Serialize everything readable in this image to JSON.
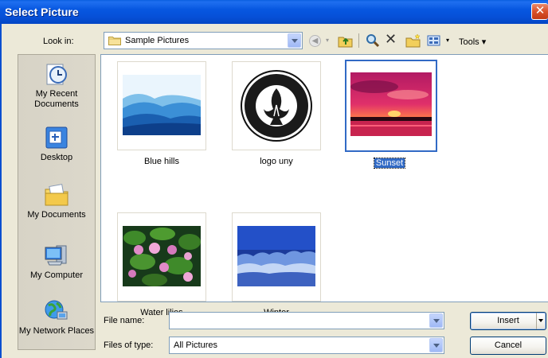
{
  "window": {
    "title": "Select Picture",
    "close_glyph": "✕"
  },
  "toolbar": {
    "look_in_label": "Look in:",
    "look_in_value": "Sample Pictures",
    "tools_label": "Tools",
    "tools_arrow": "▾",
    "delete_glyph": "✕",
    "back_glyph": "◀",
    "dropdown_glyph": "▾"
  },
  "places": [
    {
      "label": "My Recent Documents",
      "icon": "recent-documents-icon"
    },
    {
      "label": "Desktop",
      "icon": "desktop-icon"
    },
    {
      "label": "My Documents",
      "icon": "my-documents-icon"
    },
    {
      "label": "My Computer",
      "icon": "my-computer-icon"
    },
    {
      "label": "My Network Places",
      "icon": "network-places-icon"
    }
  ],
  "files": [
    {
      "name": "Blue hills",
      "selected": false
    },
    {
      "name": "logo uny",
      "selected": false
    },
    {
      "name": "Sunset",
      "selected": true
    },
    {
      "name": "Water lilies",
      "selected": false
    },
    {
      "name": "Winter",
      "selected": false
    }
  ],
  "bottom": {
    "file_name_label": "File name:",
    "file_name_value": "",
    "files_of_type_label": "Files of type:",
    "files_of_type_value": "All Pictures",
    "insert_label": "Insert",
    "cancel_label": "Cancel"
  },
  "colors": {
    "titlebar": "#0757e0",
    "selection": "#316ac5",
    "dialog_bg": "#ece9d8"
  }
}
